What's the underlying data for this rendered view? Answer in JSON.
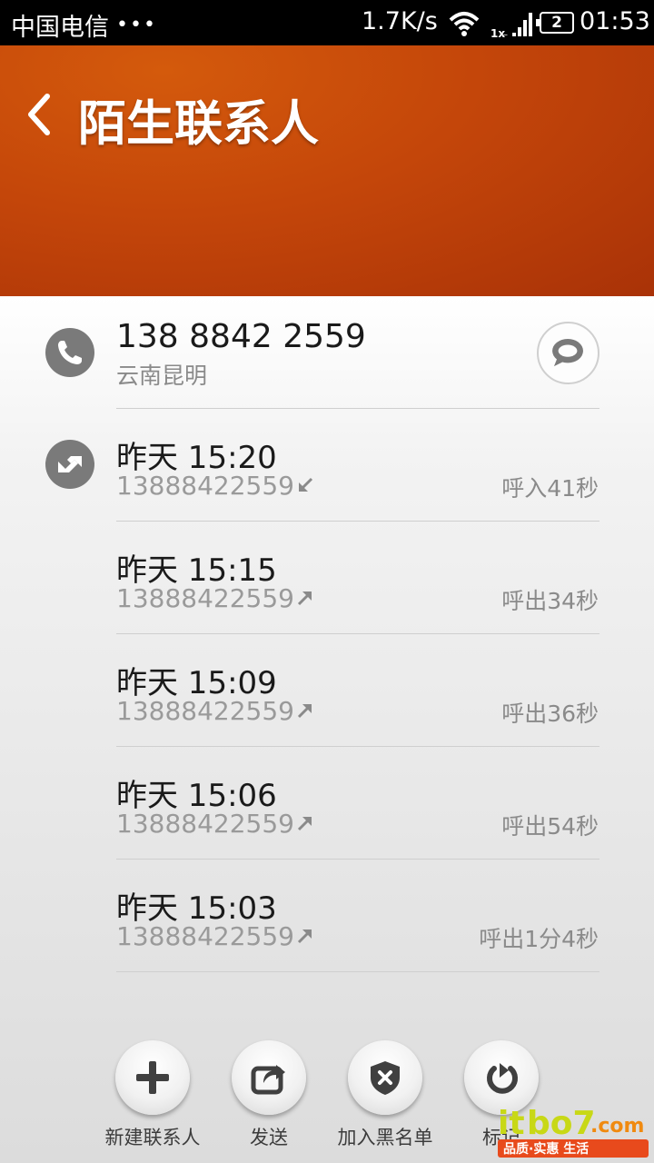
{
  "status_bar": {
    "carrier": "中国电信",
    "dots": "•••",
    "speed": "1.7K/s",
    "battery": "2",
    "time": "01:53"
  },
  "header": {
    "title": "陌生联系人"
  },
  "contact": {
    "number": "138 8842 2559",
    "location": "云南昆明"
  },
  "call_log": [
    {
      "time": "昨天 15:20",
      "number": "13888422559",
      "direction": "incoming",
      "duration": "呼入41秒"
    },
    {
      "time": "昨天 15:15",
      "number": "13888422559",
      "direction": "outgoing",
      "duration": "呼出34秒"
    },
    {
      "time": "昨天 15:09",
      "number": "13888422559",
      "direction": "outgoing",
      "duration": "呼出36秒"
    },
    {
      "time": "昨天 15:06",
      "number": "13888422559",
      "direction": "outgoing",
      "duration": "呼出54秒"
    },
    {
      "time": "昨天 15:03",
      "number": "13888422559",
      "direction": "outgoing",
      "duration": "呼出1分4秒"
    }
  ],
  "actions": [
    {
      "label": "新建联系人",
      "icon": "plus-icon"
    },
    {
      "label": "发送",
      "icon": "share-icon"
    },
    {
      "label": "加入黑名单",
      "icon": "shield-block-icon"
    },
    {
      "label": "标记",
      "icon": "tag-icon"
    }
  ],
  "watermark": {
    "brand": "itbo7.com",
    "tagline": "品质·实惠 生活"
  },
  "colors": {
    "header": "#c4460a",
    "text_primary": "#1a1a1a",
    "text_secondary": "#9a9a9a"
  }
}
